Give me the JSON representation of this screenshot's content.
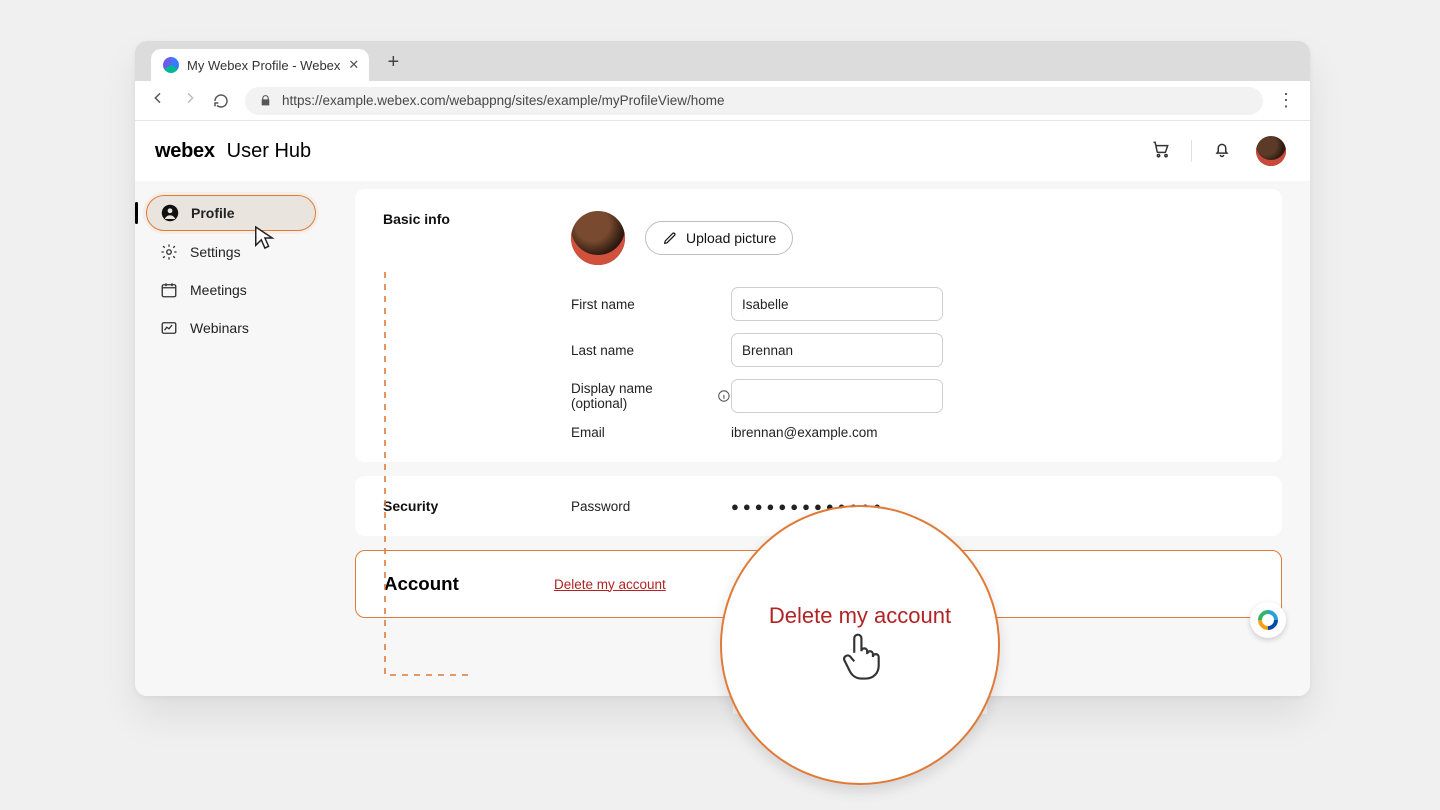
{
  "browser": {
    "tab_title": "My Webex Profile - Webex",
    "url": "https://example.webex.com/webappng/sites/example/myProfileView/home"
  },
  "header": {
    "brand_primary": "webex",
    "brand_secondary": "User Hub"
  },
  "sidebar": {
    "items": [
      {
        "label": "Profile",
        "icon": "user",
        "active": true
      },
      {
        "label": "Settings",
        "icon": "gear",
        "active": false
      },
      {
        "label": "Meetings",
        "icon": "calendar",
        "active": false
      },
      {
        "label": "Webinars",
        "icon": "chart",
        "active": false
      }
    ]
  },
  "basic_info": {
    "section_title": "Basic info",
    "upload_label": "Upload picture",
    "first_name_label": "First name",
    "first_name_value": "Isabelle",
    "last_name_label": "Last name",
    "last_name_value": "Brennan",
    "display_name_label": "Display name (optional)",
    "display_name_value": "",
    "email_label": "Email",
    "email_value": "ibrennan@example.com"
  },
  "security": {
    "section_title": "Security",
    "password_label": "Password",
    "password_mask": "●●●●●●●●●●●●●"
  },
  "account": {
    "section_title": "Account",
    "delete_label": "Delete my account"
  },
  "zoom": {
    "text": "Delete my account"
  }
}
